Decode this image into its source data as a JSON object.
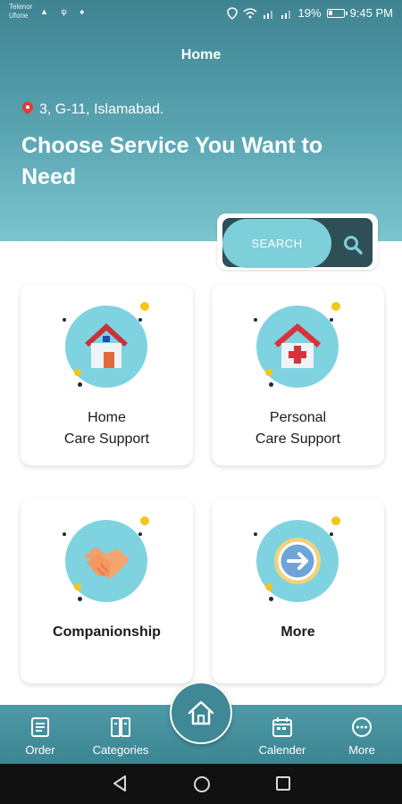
{
  "status_bar": {
    "carrier_line1": "Telenor",
    "carrier_line2": "Ufone",
    "battery": "19%",
    "time": "9:45 PM"
  },
  "header": {
    "title": "Home",
    "location": "3, G-11, Islamabad.",
    "headline": "Choose Service You Want to Need"
  },
  "search": {
    "label": "SEARCH",
    "icon": "search-icon"
  },
  "services": [
    {
      "line1": "Home",
      "line2": "Care Support",
      "icon": "house-icon"
    },
    {
      "line1": "Personal",
      "line2": "Care Support",
      "icon": "hospital-icon"
    },
    {
      "line1": "Companionship",
      "icon": "handshake-icon"
    },
    {
      "line1": "More",
      "icon": "arrow-circle-icon"
    }
  ],
  "bottom_nav": {
    "order": "Order",
    "categories": "Categories",
    "calender": "Calender",
    "more": "More"
  },
  "colors": {
    "header_top": "#3f8391",
    "accent": "#7dcfd9",
    "icon_circle": "#7fd3e0",
    "nav": "#3c8593"
  }
}
